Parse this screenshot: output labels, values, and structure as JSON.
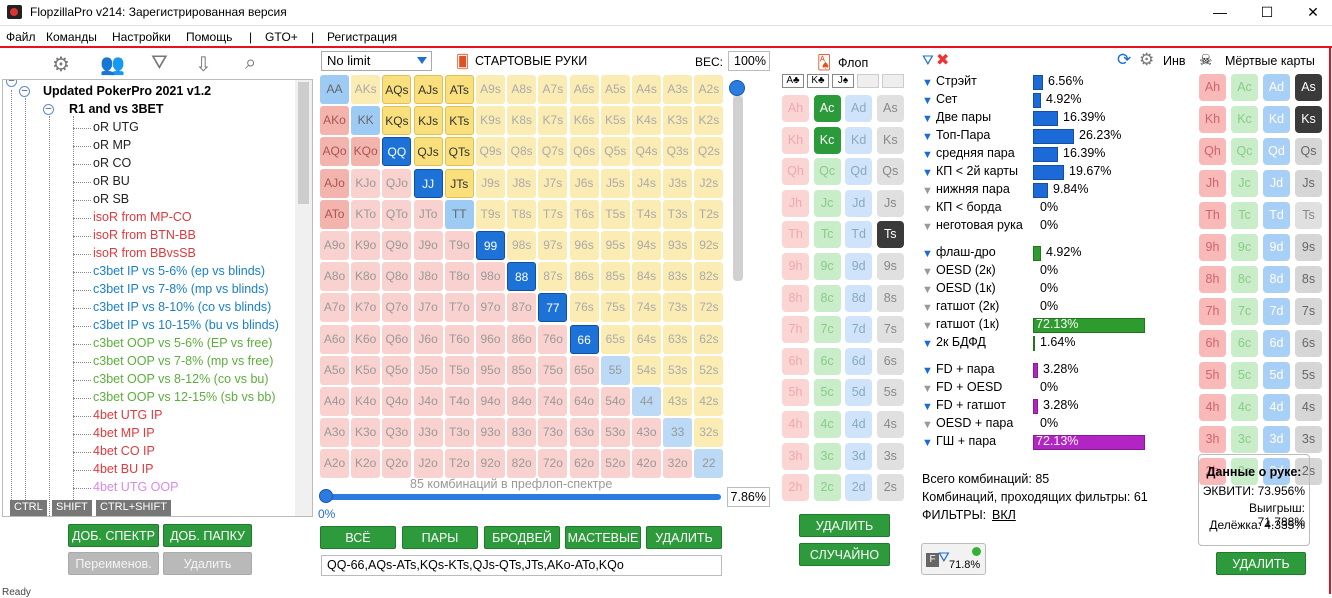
{
  "window": {
    "title": "FlopzillaPro v214: Зарегистрированная версия",
    "min": "—",
    "max": "☐",
    "close": "✕"
  },
  "menu": [
    "Файл",
    "Команды",
    "Настройки",
    "Помощь",
    "|",
    "GTO+",
    "|",
    "Регистрация"
  ],
  "tree": {
    "root": "Updated PokerPro 2021 v1.2",
    "group": "R1 and vs 3BET",
    "items": [
      {
        "label": "oR UTG",
        "color": "#222"
      },
      {
        "label": "oR MP",
        "color": "#222"
      },
      {
        "label": "oR CO",
        "color": "#222"
      },
      {
        "label": "oR BU",
        "color": "#222"
      },
      {
        "label": "oR SB",
        "color": "#222"
      },
      {
        "label": "isoR from MP-CO",
        "color": "#e0393e"
      },
      {
        "label": "isoR from BTN-BB",
        "color": "#e0393e"
      },
      {
        "label": "isoR from BBvsSB",
        "color": "#e0393e"
      },
      {
        "label": "c3bet IP vs 5-6% (ep vs blinds)",
        "color": "#1a7fc8"
      },
      {
        "label": "c3bet IP vs 7-8% (mp vs blinds)",
        "color": "#1a7fc8"
      },
      {
        "label": "c3bet IP vs 8-10% (co vs blinds)",
        "color": "#1a7fc8"
      },
      {
        "label": "c3bet IP vs 10-15% (bu vs blinds)",
        "color": "#1a7fc8"
      },
      {
        "label": "c3bet OOP vs 5-6% (EP vs free)",
        "color": "#5cae3c"
      },
      {
        "label": "c3bet OOP vs 7-8% (mp vs free)",
        "color": "#5cae3c"
      },
      {
        "label": "c3bet OOP vs 8-12% (co vs bu)",
        "color": "#5cae3c"
      },
      {
        "label": "c3bet OOP vs 12-15% (sb vs bb)",
        "color": "#5cae3c"
      },
      {
        "label": "4bet UTG IP",
        "color": "#e0393e"
      },
      {
        "label": "4bet MP IP",
        "color": "#e0393e"
      },
      {
        "label": "4bet CO IP",
        "color": "#e0393e"
      },
      {
        "label": "4bet BU IP",
        "color": "#e0393e"
      },
      {
        "label": "4bet UTG OOP",
        "color": "#d98ae8"
      }
    ]
  },
  "keys": [
    "CTRL",
    "SHIFT",
    "CTRL+SHIFT"
  ],
  "left_buttons": {
    "add_range": "ДОБ. СПЕКТР",
    "add_folder": "ДОБ. ПАПКУ",
    "rename": "Переименов.",
    "delete": "Удалить"
  },
  "range": {
    "game": "No limit",
    "start_hands": "СТАРТОВЫЕ РУКИ",
    "weight_label": "ВЕС:",
    "weight": "100%",
    "combos_text": "85 комбинаций в префлоп-спектре",
    "pct": "7.86%",
    "slider_min": "0%",
    "text": "QQ-66,AQs-ATs,KQs-KTs,QJs-QTs,JTs,AKo-ATo,KQo"
  },
  "ranks": [
    "A",
    "K",
    "Q",
    "J",
    "T",
    "9",
    "8",
    "7",
    "6",
    "5",
    "4",
    "3",
    "2"
  ],
  "selected_hands": [
    "AQs",
    "AJs",
    "ATs",
    "KQs",
    "KJs",
    "KTs",
    "QQ",
    "QJs",
    "QTs",
    "JJ",
    "JTs",
    "TT",
    "99",
    "88",
    "77",
    "66",
    "AKo",
    "AQo",
    "AJo",
    "ATo",
    "KQo"
  ],
  "range_buttons": [
    "ВСЁ",
    "ПАРЫ",
    "БРОДВЕЙ",
    "МАСТЕВЫЕ",
    "УДАЛИТЬ"
  ],
  "flop": {
    "title": "Флоп",
    "suits": [
      "A♣",
      "K♣",
      "J♠",
      "",
      ""
    ],
    "delete": "УДАЛИТЬ",
    "random": "СЛУЧАЙНО",
    "ranks": [
      "A",
      "K",
      "Q",
      "J",
      "T",
      "9",
      "8",
      "7",
      "6",
      "5",
      "4",
      "3",
      "2"
    ],
    "selected": [
      "Ac",
      "Kc",
      "Ts"
    ]
  },
  "stats": {
    "inv": "Инв",
    "rows": [
      {
        "label": "Стрэйт",
        "value": "6.56%",
        "frac": 0.066,
        "color": "#1c6ad8"
      },
      {
        "label": "Сет",
        "value": "4.92%",
        "frac": 0.049,
        "color": "#1c6ad8"
      },
      {
        "label": "Две пары",
        "value": "16.39%",
        "frac": 0.164,
        "color": "#1c6ad8"
      },
      {
        "label": "Топ-Пара",
        "value": "26.23%",
        "frac": 0.262,
        "color": "#1c6ad8"
      },
      {
        "label": "средняя пара",
        "value": "16.39%",
        "frac": 0.164,
        "color": "#1c6ad8"
      },
      {
        "label": "КП < 2й карты",
        "value": "19.67%",
        "frac": 0.197,
        "color": "#1c6ad8"
      },
      {
        "label": "нижняя пара",
        "value": "9.84%",
        "frac": 0.098,
        "color": "#1c6ad8"
      },
      {
        "label": "КП < борда",
        "value": "0%",
        "frac": 0,
        "color": "#1c6ad8"
      },
      {
        "label": "неготовая рука",
        "value": "0%",
        "frac": 0,
        "color": "#1c6ad8"
      },
      {
        "label": "флаш-дро",
        "value": "4.92%",
        "frac": 0.049,
        "color": "#2e9b2e"
      },
      {
        "label": "OESD (2к)",
        "value": "0%",
        "frac": 0,
        "color": "#2e9b2e"
      },
      {
        "label": "OESD (1к)",
        "value": "0%",
        "frac": 0,
        "color": "#2e9b2e"
      },
      {
        "label": "гатшот (2к)",
        "value": "0%",
        "frac": 0,
        "color": "#2e9b2e"
      },
      {
        "label": "гатшот (1к)",
        "value": "72.13%",
        "frac": 0.721,
        "color": "#2e9b2e"
      },
      {
        "label": "2к БДФД",
        "value": "1.64%",
        "frac": 0.016,
        "color": "#2e9b2e"
      },
      {
        "label": "FD + пара",
        "value": "3.28%",
        "frac": 0.033,
        "color": "#b324c4"
      },
      {
        "label": "FD + OESD",
        "value": "0%",
        "frac": 0,
        "color": "#b324c4"
      },
      {
        "label": "FD + гатшот",
        "value": "3.28%",
        "frac": 0.033,
        "color": "#b324c4"
      },
      {
        "label": "OESD + пара",
        "value": "0%",
        "frac": 0,
        "color": "#b324c4"
      },
      {
        "label": "ГШ + пара",
        "value": "72.13%",
        "frac": 0.721,
        "color": "#b324c4"
      }
    ],
    "total": "Всего комбинаций: 85",
    "passing": "Комбинаций, проходящих фильтры: 61",
    "filters_label": "ФИЛЬТРЫ:",
    "filters_value": "ВКЛ",
    "badge": "71.8%"
  },
  "dead": {
    "title": "Мёртвые карты",
    "ranks": [
      "A",
      "K",
      "Q",
      "J",
      "T",
      "9",
      "8",
      "7",
      "6",
      "5",
      "4",
      "3",
      "2"
    ],
    "selected": [
      "As",
      "Ks"
    ],
    "delete": "УДАЛИТЬ"
  },
  "hand_data": {
    "title": "Данные о руке:",
    "equity": "ЭКВИТИ: 73.956%",
    "win": "Выигрыш: 71.788%",
    "split": "Делёжка: 4.335%"
  },
  "status": "Ready"
}
